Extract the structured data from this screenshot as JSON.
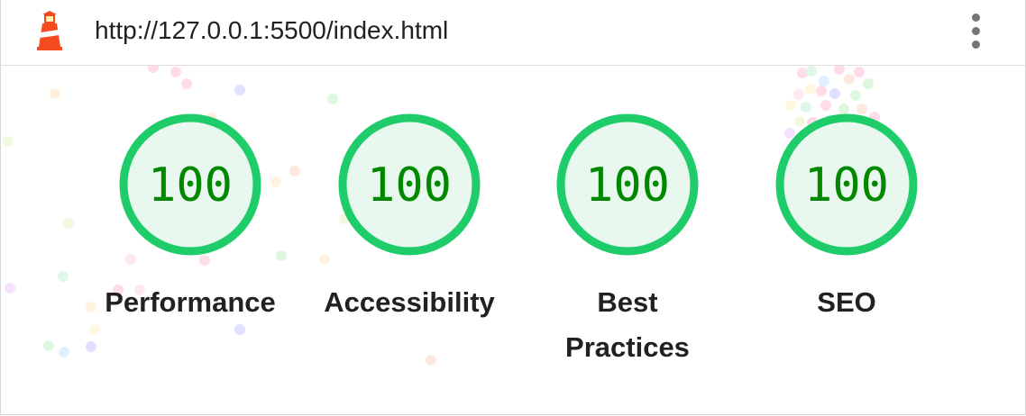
{
  "topbar": {
    "url": "http://127.0.0.1:5500/index.html",
    "logo_icon": "lighthouse-icon",
    "menu_icon": "more-vert-icon"
  },
  "colors": {
    "pass_ring": "#1fcc6a",
    "pass_fill": "#e8f8ee",
    "pass_text": "#008800"
  },
  "gauges": [
    {
      "label": "Performance",
      "score": "100"
    },
    {
      "label": "Accessibility",
      "score": "100"
    },
    {
      "label": "Best Practices",
      "score": "100"
    },
    {
      "label": "SEO",
      "score": "100"
    }
  ]
}
